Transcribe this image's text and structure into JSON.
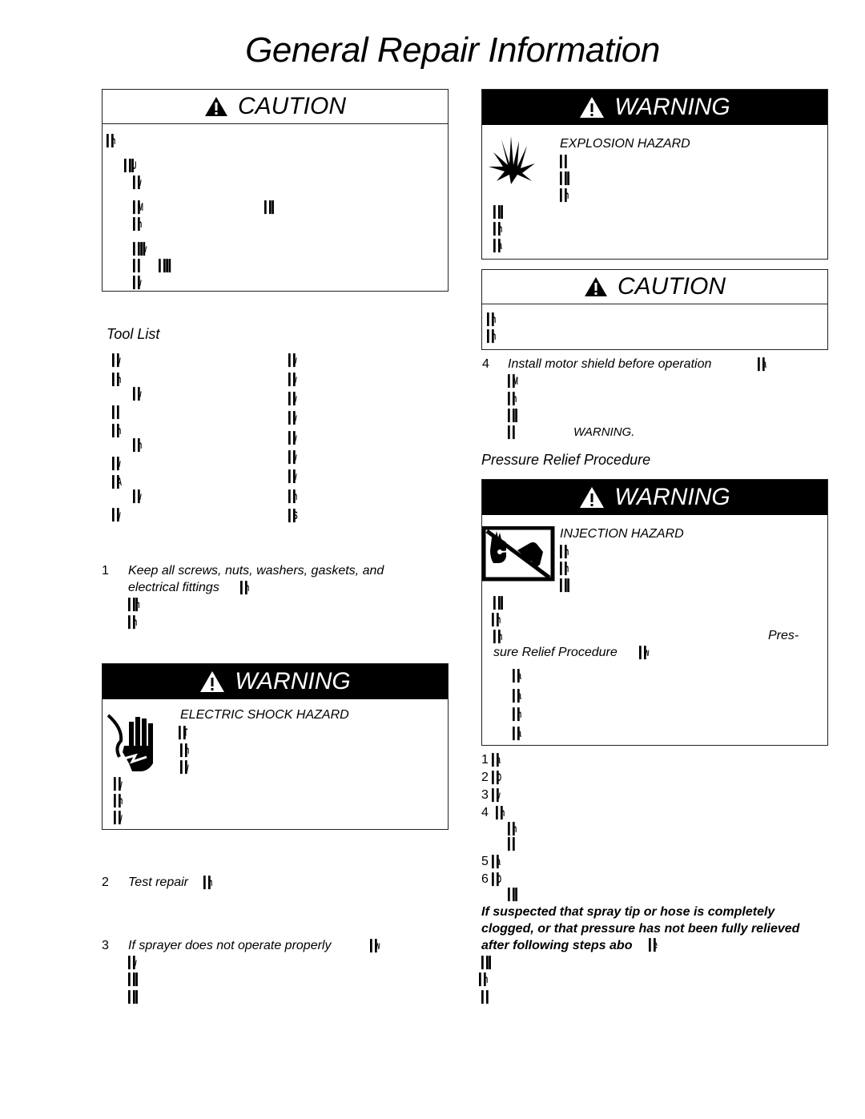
{
  "page": {
    "title": "General Repair Information"
  },
  "left": {
    "caution_box": {
      "header": "CAUTION",
      "lines": [
        "▌▐h",
        "▌▐▐U",
        "▌▐v",
        "▌▐M",
        "▌▐▐",
        "▌▐h",
        "▌▐▐▐v",
        "▌▐",
        "▌▐▐▐",
        "▌▐v"
      ]
    },
    "tool_list": {
      "heading": "Tool List",
      "col1": [
        "▌▐v",
        "▌▐h",
        "▌▐v",
        "▌▐l",
        "▌▐h",
        "▌▐h",
        "▌▐v",
        "▌▐A",
        "▌▐v",
        "▌▐y"
      ],
      "col2": [
        "▌▐v",
        "▌▐v",
        "▌▐v",
        "▌▐v",
        "▌▐v",
        "▌▐v",
        "▌▐v",
        "▌▐h",
        "▌▐S"
      ]
    },
    "step1": {
      "number": "1",
      "text_line1": "Keep all screws, nuts, washers, gaskets, and",
      "text_line2": "electrical fittings",
      "g1": "▌▐h",
      "g2": "▌▐▐h",
      "g3": "▌▐h"
    },
    "warning_box": {
      "header": "WARNING",
      "hazard": "ELECTRIC SHOCK HAZARD",
      "icon": "electric-shock-hand-icon",
      "lines": [
        "▌▐T",
        "▌▐h",
        "▌▐y",
        "▌▐y",
        "▌▐n",
        "▌▐y"
      ]
    },
    "step2": {
      "number": "2",
      "text": "Test repair",
      "g": "▌▐h"
    },
    "step3": {
      "number": "3",
      "text": "If sprayer does not operate properly",
      "g": "▌▐w",
      "lines": [
        "▌▐v",
        "▌▐▐",
        "▌▐▐"
      ]
    }
  },
  "right": {
    "warning_explosion": {
      "header": "WARNING",
      "hazard": "EXPLOSION HAZARD",
      "icon": "explosion-icon",
      "lines": [
        "▌▐l",
        "▌▐▐",
        "▌▐h",
        "▌▐▐",
        "▌▐h",
        "▌▐a"
      ]
    },
    "caution_box": {
      "header": "CAUTION",
      "lines": [
        "▌▐h",
        "▌▐h"
      ]
    },
    "step4": {
      "number": "4",
      "text": "Install motor shield before operation",
      "g": "▌▐a",
      "lines": [
        "▌▐M",
        "▌▐h",
        "▌▐▐",
        "▌▐"
      ],
      "ref": "WARNING."
    },
    "pressure_relief": {
      "heading": "Pressure Relief Procedure",
      "warning_box": {
        "header": "WARNING",
        "hazard": "INJECTION HAZARD",
        "icon": "injection-hazard-icon",
        "lines_top": [
          "▌▐h",
          "▌▐h",
          "▌▐▐"
        ],
        "lines_mid": [
          "▌▐▐",
          "▌▐h",
          "▌▐h"
        ],
        "ref_part1": "Pres-",
        "ref_part2": "sure Relief Procedure",
        "ref_g": "▌▐w",
        "lines_bottom": [
          "▌▐a",
          "▌▐a",
          "▌▐n",
          "▌▐a"
        ]
      },
      "steps": [
        {
          "number": "1",
          "g": "▌▐a"
        },
        {
          "number": "2",
          "g": "▌▐D"
        },
        {
          "number": "3",
          "g": "▌▐v"
        },
        {
          "number": "4",
          "g": "▌▐h"
        },
        {
          "number": "",
          "g": "▌▐h"
        },
        {
          "number": "",
          "g": "▌▐"
        },
        {
          "number": "5",
          "g": "▌▐a"
        },
        {
          "number": "6",
          "g": "▌▐D"
        },
        {
          "number": "",
          "g": "▌▐▐"
        }
      ],
      "note_line1": "If suspected that spray tip or hose is completely",
      "note_line2": "clogged, or that pressure has not been fully relieved",
      "note_line3": "after following steps abo",
      "note_g": "▌▐e",
      "tail": [
        "▌▐▐",
        "▌▐h",
        "▌▐"
      ]
    }
  }
}
